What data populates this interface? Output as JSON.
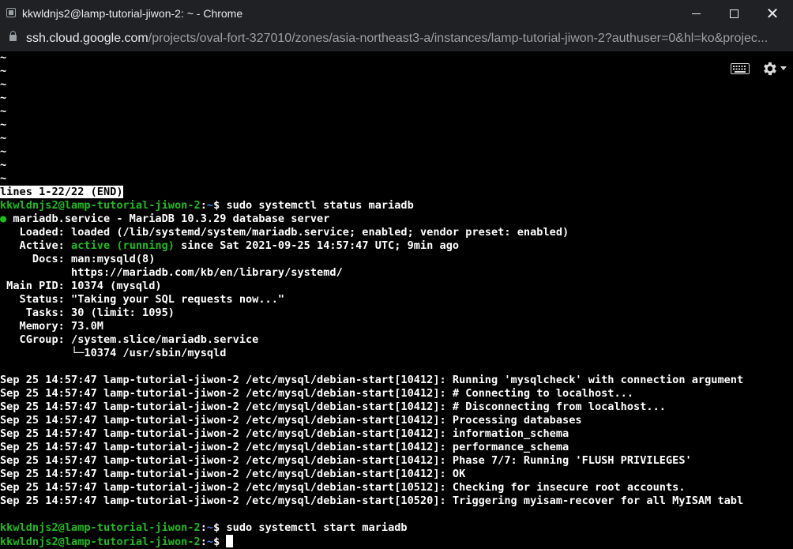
{
  "window": {
    "title": "kkwldnjs2@lamp-tutorial-jiwon-2: ~ - Chrome"
  },
  "address": {
    "host": "ssh.cloud.google.com",
    "path": "/projects/oval-fort-327010/zones/asia-northeast3-a/instances/lamp-tutorial-jiwon-2?authuser=0&hl=ko&projec..."
  },
  "terminal": {
    "tools": {
      "keyboard_icon": "keyboard-icon",
      "settings_icon": "gear-icon"
    },
    "lines": [
      [
        {
          "t": "~"
        }
      ],
      [
        {
          "t": "~"
        }
      ],
      [
        {
          "t": "~"
        }
      ],
      [
        {
          "t": "~"
        }
      ],
      [
        {
          "t": "~"
        }
      ],
      [
        {
          "t": "~"
        }
      ],
      [
        {
          "t": "~"
        }
      ],
      [
        {
          "t": "~"
        }
      ],
      [
        {
          "t": "~"
        }
      ],
      [
        {
          "t": "~"
        }
      ],
      [
        {
          "t": "lines 1-22/22 (END)",
          "c": "inverse"
        }
      ],
      [
        {
          "t": "kkwldnjs2@lamp-tutorial-jiwon-2",
          "c": "green"
        },
        {
          "t": ":"
        },
        {
          "t": "~",
          "c": "blue"
        },
        {
          "t": "$ sudo systemctl status mariadb"
        }
      ],
      [
        {
          "t": "●",
          "c": "green"
        },
        {
          "t": " mariadb.service - MariaDB 10.3.29 database server"
        }
      ],
      [
        {
          "t": "   Loaded: loaded (/lib/systemd/system/mariadb.service; enabled; vendor preset: enabled)"
        }
      ],
      [
        {
          "t": "   Active: "
        },
        {
          "t": "active (running)",
          "c": "green"
        },
        {
          "t": " since Sat 2021-09-25 14:57:47 UTC; 9min ago"
        }
      ],
      [
        {
          "t": "     Docs: man:mysqld(8)"
        }
      ],
      [
        {
          "t": "           https://mariadb.com/kb/en/library/systemd/"
        }
      ],
      [
        {
          "t": " Main PID: 10374 (mysqld)"
        }
      ],
      [
        {
          "t": "   Status: \"Taking your SQL requests now...\""
        }
      ],
      [
        {
          "t": "    Tasks: 30 (limit: 1095)"
        }
      ],
      [
        {
          "t": "   Memory: 73.0M"
        }
      ],
      [
        {
          "t": "   CGroup: /system.slice/mariadb.service"
        }
      ],
      [
        {
          "t": "           └─10374 /usr/sbin/mysqld"
        }
      ],
      [
        {
          "t": ""
        }
      ],
      [
        {
          "t": "Sep 25 14:57:47 lamp-tutorial-jiwon-2 /etc/mysql/debian-start[10412]: Running 'mysqlcheck' with connection argument"
        }
      ],
      [
        {
          "t": "Sep 25 14:57:47 lamp-tutorial-jiwon-2 /etc/mysql/debian-start[10412]: # Connecting to localhost..."
        }
      ],
      [
        {
          "t": "Sep 25 14:57:47 lamp-tutorial-jiwon-2 /etc/mysql/debian-start[10412]: # Disconnecting from localhost..."
        }
      ],
      [
        {
          "t": "Sep 25 14:57:47 lamp-tutorial-jiwon-2 /etc/mysql/debian-start[10412]: Processing databases"
        }
      ],
      [
        {
          "t": "Sep 25 14:57:47 lamp-tutorial-jiwon-2 /etc/mysql/debian-start[10412]: information_schema"
        }
      ],
      [
        {
          "t": "Sep 25 14:57:47 lamp-tutorial-jiwon-2 /etc/mysql/debian-start[10412]: performance_schema"
        }
      ],
      [
        {
          "t": "Sep 25 14:57:47 lamp-tutorial-jiwon-2 /etc/mysql/debian-start[10412]: Phase 7/7: Running 'FLUSH PRIVILEGES'"
        }
      ],
      [
        {
          "t": "Sep 25 14:57:47 lamp-tutorial-jiwon-2 /etc/mysql/debian-start[10412]: OK"
        }
      ],
      [
        {
          "t": "Sep 25 14:57:47 lamp-tutorial-jiwon-2 /etc/mysql/debian-start[10512]: Checking for insecure root accounts."
        }
      ],
      [
        {
          "t": "Sep 25 14:57:47 lamp-tutorial-jiwon-2 /etc/mysql/debian-start[10520]: Triggering myisam-recover for all MyISAM tabl"
        }
      ],
      [
        {
          "t": ""
        }
      ],
      [
        {
          "t": "kkwldnjs2@lamp-tutorial-jiwon-2",
          "c": "green"
        },
        {
          "t": ":"
        },
        {
          "t": "~",
          "c": "blue"
        },
        {
          "t": "$ sudo systemctl start mariadb"
        }
      ],
      [
        {
          "t": "kkwldnjs2@lamp-tutorial-jiwon-2",
          "c": "green"
        },
        {
          "t": ":"
        },
        {
          "t": "~",
          "c": "blue"
        },
        {
          "t": "$ "
        },
        {
          "cursor": true
        }
      ]
    ]
  }
}
